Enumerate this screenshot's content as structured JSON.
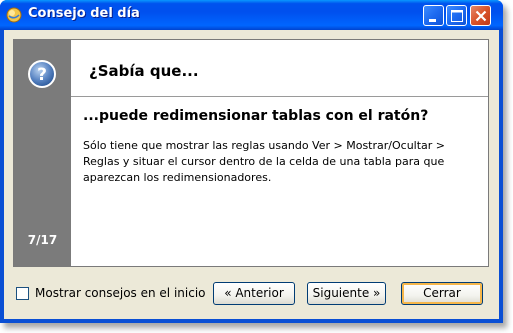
{
  "window": {
    "title": "Consejo del día",
    "title_icon": "app-globe-icon"
  },
  "tip": {
    "heading": "¿Sabía que...",
    "counter": "7/17",
    "title": "...puede redimensionar tablas con el ratón?",
    "body": "Sólo tiene que mostrar las reglas usando Ver > Mostrar/Ocultar > Reglas y situar el cursor dentro de la celda de una tabla para que aparezcan los redimensionadores.",
    "icon": "help-question-icon"
  },
  "footer": {
    "show_tips_label": "Mostrar consejos en el inicio",
    "show_tips_checked": false,
    "prev_label": "« Anterior",
    "next_label": "Siguiente »",
    "close_label": "Cerrar"
  },
  "colors": {
    "titlebar": "#0053ee",
    "client": "#ece9d8",
    "sidebar": "#7b7b7b",
    "close_button": "#d9542a",
    "default_button_focus": "#f5b64a"
  }
}
